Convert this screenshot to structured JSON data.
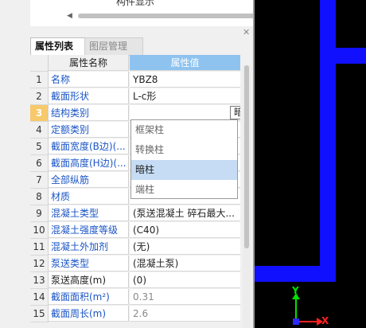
{
  "top_pane": {
    "clipped_text": "构件显示"
  },
  "tabs": [
    {
      "label": "属性列表",
      "active": true
    },
    {
      "label": "图层管理",
      "active": false
    }
  ],
  "table": {
    "header_name": "属性名称",
    "header_value": "属性值",
    "selected_row": 3,
    "rows": [
      {
        "index": "1",
        "name": "名称",
        "value": "YBZ8"
      },
      {
        "index": "2",
        "name": "截面形状",
        "value": "L-c形"
      },
      {
        "index": "3",
        "name": "结构类别",
        "value": "暗柱"
      },
      {
        "index": "4",
        "name": "定额类别",
        "value": ""
      },
      {
        "index": "5",
        "name": "截面宽度(B边)(...",
        "value": ""
      },
      {
        "index": "6",
        "name": "截面高度(H边)(...",
        "value": ""
      },
      {
        "index": "7",
        "name": "全部纵筋",
        "value": ""
      },
      {
        "index": "8",
        "name": "材质",
        "value": ""
      },
      {
        "index": "9",
        "name": "混凝土类型",
        "value": "(泵送混凝土 碎石最大..."
      },
      {
        "index": "10",
        "name": "混凝土强度等级",
        "value": "(C40)"
      },
      {
        "index": "11",
        "name": "混凝土外加剂",
        "value": "(无)"
      },
      {
        "index": "12",
        "name": "泵送类型",
        "value": "(混凝土泵)"
      },
      {
        "index": "13",
        "name": "泵送高度(m)",
        "value": "(0)"
      },
      {
        "index": "14",
        "name": "截面面积(m²)",
        "value": "0.31"
      },
      {
        "index": "15",
        "name": "截面周长(m)",
        "value": "2.6"
      }
    ]
  },
  "dropdown": {
    "options": [
      "框架柱",
      "转换柱",
      "暗柱",
      "端柱"
    ],
    "highlighted": "暗柱"
  },
  "axis": {
    "y_label": "Y",
    "x_label": "X"
  },
  "colors": {
    "wall": "#1010ff",
    "header_value_bg": "#8ec3f0",
    "selected_index_bg": "#f7c96b",
    "link_text": "#1a55c5"
  }
}
